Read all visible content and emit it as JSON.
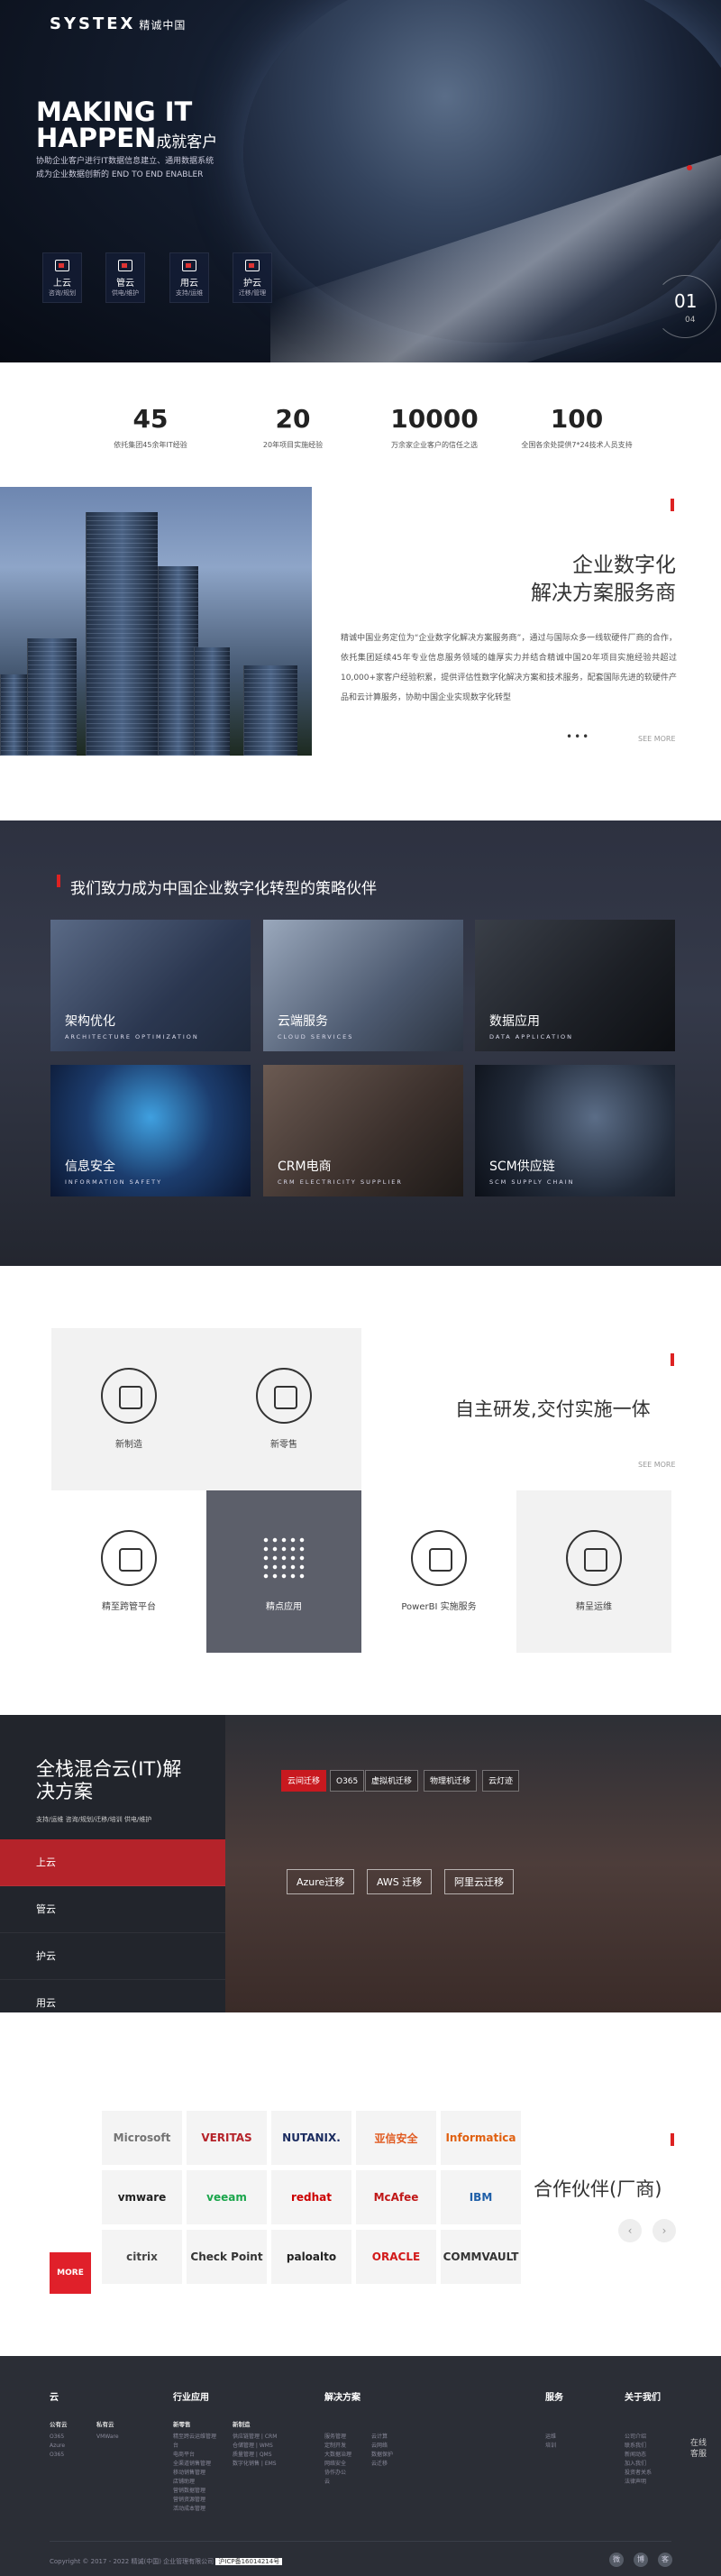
{
  "header": {
    "logo": "SYSTEX",
    "logo_cn": "精诚中国"
  },
  "hero": {
    "title_line1": "MAKING IT",
    "title_line2": "HAPPEN",
    "title_suffix": "成就客户",
    "desc_line1": "协助企业客户进行IT数据信息建立、通用数据系统",
    "desc_line2": "成为企业数据创新的 END TO END ENABLER",
    "quick_links": [
      {
        "title": "上云",
        "sub": "咨询/规划"
      },
      {
        "title": "管云",
        "sub": "供电/维护"
      },
      {
        "title": "用云",
        "sub": "支持/运维"
      },
      {
        "title": "护云",
        "sub": "迁移/管理"
      }
    ],
    "slide_current": "01",
    "slide_total": "04"
  },
  "stats": [
    {
      "num": "45",
      "label": "依托集团45余年IT经验"
    },
    {
      "num": "20",
      "label": "20年项目实施经验"
    },
    {
      "num": "10000",
      "label": "万余家企业客户的信任之选"
    },
    {
      "num": "100",
      "label": "全国各余处提供7*24技术人员支持"
    }
  ],
  "enterprise": {
    "title_line1": "企业数字化",
    "title_line2": "解决方案服务商",
    "text": "精诚中国业务定位为“企业数字化解决方案服务商”，通过与国际众多一线软硬件厂商的合作，依托集团延续45年专业信息服务领域的雄厚实力并结合精诚中国20年项目实施经验共超过10,000+家客户经验积累，提供评估性数字化解决方案和技术服务，配套国际先进的软硬件产品和云计算服务，协助中国企业实现数字化转型",
    "see_more": "SEE MORE"
  },
  "strategy": {
    "title": "我们致力成为中国企业数字化转型的策略伙伴",
    "cards": [
      {
        "title": "架构优化",
        "en": "ARCHITECTURE OPTIMIZATION"
      },
      {
        "title": "云端服务",
        "en": "CLOUD SERVICES"
      },
      {
        "title": "数据应用",
        "en": "DATA APPLICATION"
      },
      {
        "title": "信息安全",
        "en": "INFORMATION SAFETY"
      },
      {
        "title": "CRM电商",
        "en": "CRM ELECTRICITY SUPPLIER"
      },
      {
        "title": "SCM供应链",
        "en": "SCM SUPPLY CHAIN"
      }
    ]
  },
  "self_dev": {
    "title": "自主研发,交付实施一体",
    "see_more": "SEE MORE",
    "items": [
      "新制造",
      "新零售",
      "精至跨管平台",
      "精点应用",
      "PowerBI 实施服务",
      "精呈运维"
    ]
  },
  "hybrid": {
    "title": "全栈混合云(IT)解决方案",
    "subtitle": "支持/运维 咨询/规划/迁移/培训 供电/维护",
    "menu": [
      "上云",
      "管云",
      "护云",
      "用云"
    ],
    "tabs": [
      "云间迁移",
      "O365",
      "虚拟机迁移",
      "物理机迁移",
      "云灯迹"
    ],
    "buttons": [
      "Azure迁移",
      "AWS 迁移",
      "阿里云迁移"
    ]
  },
  "partners": {
    "title": "合作伙伴(厂商)",
    "more": "MORE",
    "logos": [
      {
        "name": "Microsoft",
        "color": "#737373"
      },
      {
        "name": "VERITAS",
        "color": "#b5232a"
      },
      {
        "name": "NUTANIX.",
        "color": "#1a2b5f"
      },
      {
        "name": "亚信安全",
        "color": "#e05a20"
      },
      {
        "name": "Informatica",
        "color": "#e06010"
      },
      {
        "name": "vmware",
        "color": "#222"
      },
      {
        "name": "veeam",
        "color": "#1aa54b"
      },
      {
        "name": "redhat",
        "color": "#c00"
      },
      {
        "name": "McAfee",
        "color": "#c01818"
      },
      {
        "name": "IBM",
        "color": "#1f5fa8"
      },
      {
        "name": "citrix",
        "color": "#444"
      },
      {
        "name": "Check Point",
        "color": "#333"
      },
      {
        "name": "paloalto",
        "color": "#222"
      },
      {
        "name": "ORACLE",
        "color": "#d21a1a"
      },
      {
        "name": "COMMVAULT",
        "color": "#333"
      }
    ]
  },
  "footer": {
    "cols": [
      {
        "h": "云",
        "subs": [
          {
            "s": "公有云",
            "links": [
              "O365",
              "Azure",
              "O365"
            ]
          },
          {
            "s": "私有云",
            "links": [
              "VMWare"
            ]
          }
        ]
      },
      {
        "h": "行业应用",
        "subs": [
          {
            "s": "新零售",
            "links": [
              "精至跨云运维管理",
              "台",
              "电商平台",
              "全渠道销售管理",
              "移动销售管理",
              "店铺助理",
              "营销数据管理",
              "营销资源管理",
              "活动成本管理"
            ]
          },
          {
            "s": "新制造",
            "links": [
              "供应链管理 | CRM",
              "仓储管理 | WMS",
              "质量管理 | QMS",
              "数字化销售 | EMS"
            ]
          }
        ]
      },
      {
        "h": "解决方案",
        "subs": [
          {
            "s": "",
            "links": [
              "服务管理",
              "定制开发",
              "大数据治理",
              "网络安全",
              "协作办公",
              "云"
            ]
          },
          {
            "s": "",
            "links": [
              "云计算",
              "云网络",
              "数据保护",
              "云迁移"
            ]
          }
        ]
      },
      {
        "h": "服务",
        "subs": [
          {
            "s": "",
            "links": [
              "运维",
              "培训"
            ]
          }
        ]
      },
      {
        "h": "关于我们",
        "subs": [
          {
            "s": "",
            "links": [
              "公司介绍",
              "联系我们",
              "新闻动态",
              "加入我们",
              "投资者关系",
              "法律声明"
            ]
          }
        ]
      }
    ],
    "float": "在线客服",
    "copyright": "Copyright © 2017 - 2022 精诚(中国) 企业管理有限公司",
    "icp": "沪ICP备16014214号",
    "icons": [
      "微",
      "博",
      "客"
    ]
  }
}
